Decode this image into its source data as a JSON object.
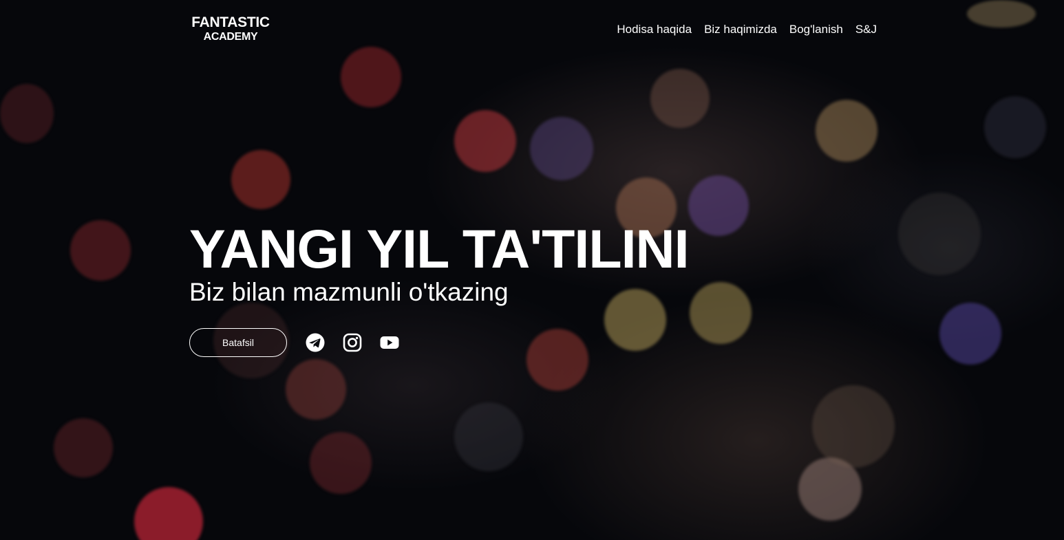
{
  "brand": {
    "line1": "FANTASTIC",
    "line2": "ACADEMY"
  },
  "nav": {
    "items": [
      {
        "label": "Hodisa haqida"
      },
      {
        "label": "Biz haqimizda"
      },
      {
        "label": "Bog'lanish"
      },
      {
        "label": "S&J"
      }
    ]
  },
  "hero": {
    "title": "YANGI YIL TA'TILINI",
    "subtitle": "Biz bilan mazmunli o'tkazing",
    "cta_label": "Batafsil"
  },
  "social": {
    "icons": [
      "telegram-icon",
      "instagram-icon",
      "youtube-icon"
    ]
  },
  "colors": {
    "background": "#06070b",
    "text": "#ffffff"
  }
}
